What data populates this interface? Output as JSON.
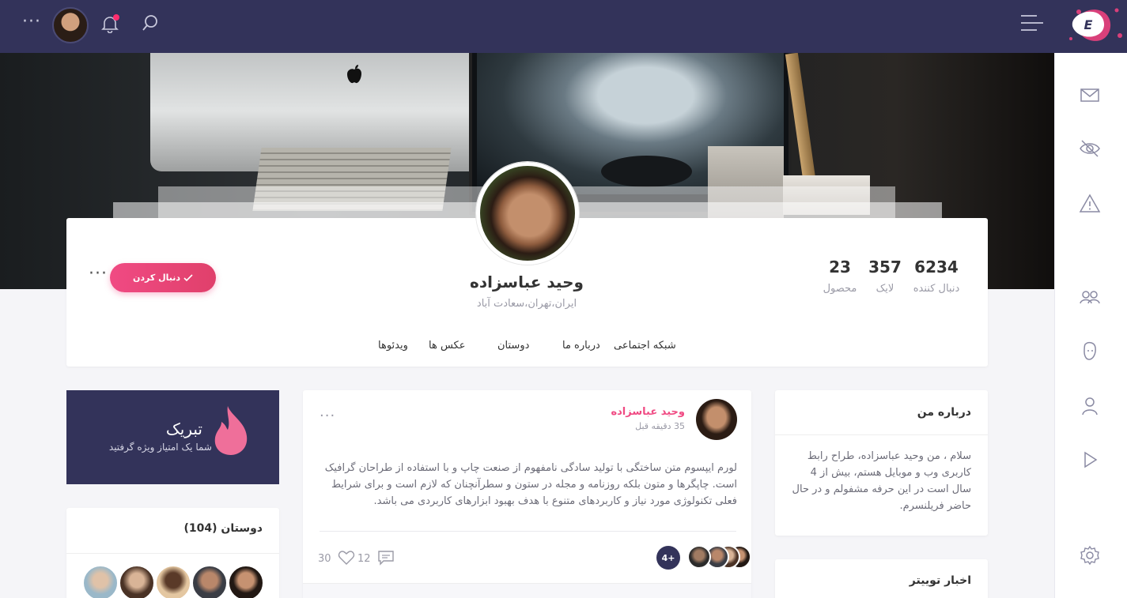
{
  "topbar": {
    "more_icon": "more-dots-icon",
    "bell_icon": "bell-icon",
    "search_icon": "search-icon",
    "menu_icon": "hamburger-menu-icon",
    "logo_letter": "E",
    "notification_color": "#ff2d6f",
    "background_color": "#33335a"
  },
  "sidebar": {
    "icons": [
      "mail-icon",
      "eye-off-icon",
      "warning-icon",
      "users-icon",
      "face-icon",
      "user-icon",
      "play-icon",
      "settings-icon"
    ]
  },
  "profile": {
    "name": "وحید عباسزاده",
    "location": "ایران،تهران،سعادت آباد",
    "follow_label": "دنبال کردن",
    "stats": [
      {
        "value": "6234",
        "label": "دنبال کننده"
      },
      {
        "value": "357",
        "label": "لایک"
      },
      {
        "value": "23",
        "label": "محصول"
      }
    ],
    "tabs": [
      "شبکه اجتماعی",
      "درباره ما",
      "دوستان",
      "عکس ها",
      "ویدئوها"
    ],
    "accent_color": "#f04a83"
  },
  "congrats": {
    "title": "تبریک",
    "subtitle": "شما یک امتیاز ویژه گرفتید"
  },
  "friends": {
    "title": "دوستان (104)"
  },
  "post": {
    "author": "وحید عباسزاده",
    "time": "35 دقیقه قبل",
    "body": "لورم ایپسوم متن ساختگی با تولید سادگی نامفهوم از صنعت چاپ و با استفاده از طراحان گرافیک است. چاپگرها و متون بلکه روزنامه و مجله در ستون و سطرآنچنان که لازم است و برای شرایط فعلی تکنولوژی مورد نیاز و کاربردهای متنوع با هدف بهبود ابزارهای کاربردی می باشد.",
    "comments": "12",
    "likes": "30",
    "more_avatars": "4+"
  },
  "about": {
    "title": "درباره من",
    "text": "سلام ، من وحید عباسزاده، طراح رابط کاربری وب و موبایل هستم، بیش از 4 سال است در این حرفه مشفولم و در حال حاضر فریلنسرم."
  },
  "twitter": {
    "title": "اخبار توییتر"
  }
}
